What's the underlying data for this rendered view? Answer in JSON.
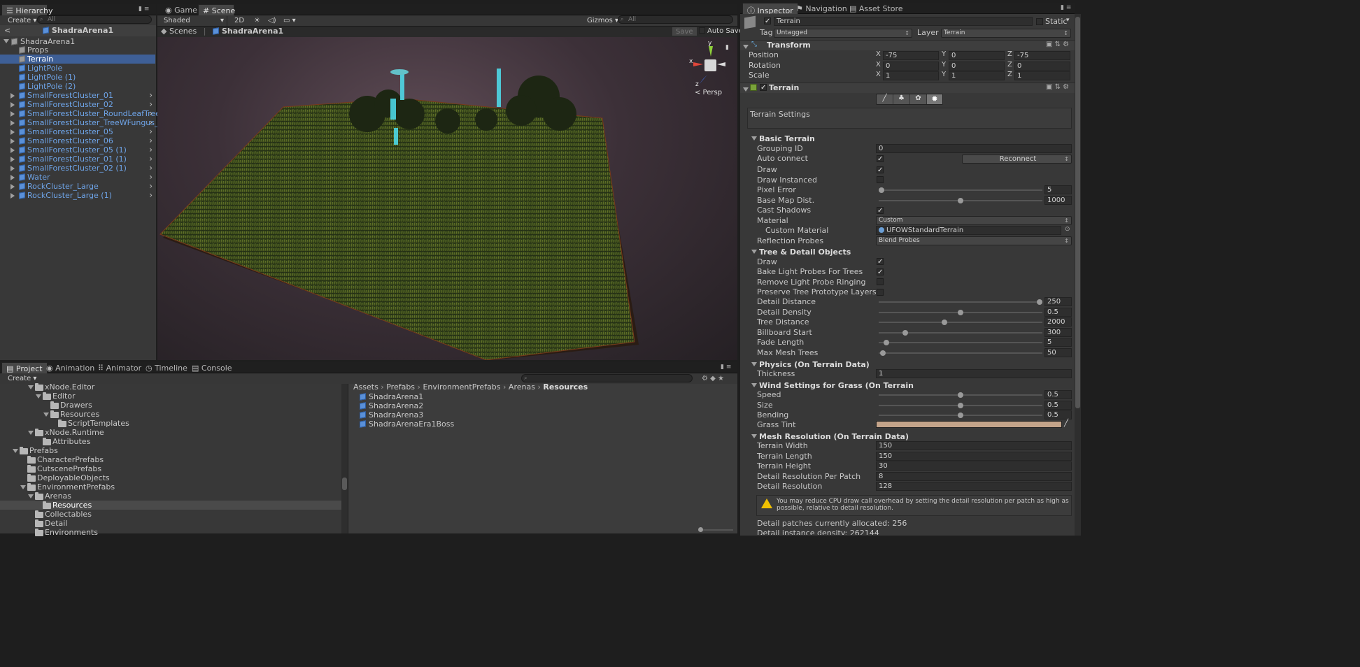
{
  "hierarchy": {
    "tab": "Hierarchy",
    "create": "Create ▾",
    "search_placeholder": "All",
    "scene": "ShadraArena1",
    "root": "ShadraArena1",
    "items": [
      {
        "label": "Props",
        "expand": false,
        "blue": false
      },
      {
        "label": "Terrain",
        "expand": false,
        "blue": false,
        "selected": true
      },
      {
        "label": "LightPole",
        "expand": false,
        "blue": true
      },
      {
        "label": "LightPole (1)",
        "expand": false,
        "blue": true
      },
      {
        "label": "LightPole (2)",
        "expand": false,
        "blue": true
      },
      {
        "label": "SmallForestCluster_01",
        "expand": true,
        "blue": true
      },
      {
        "label": "SmallForestCluster_02",
        "expand": true,
        "blue": true
      },
      {
        "label": "SmallForestCluster_RoundLeafTree_02",
        "expand": true,
        "blue": true
      },
      {
        "label": "SmallForestCluster_TreeWFungus_02",
        "expand": true,
        "blue": true
      },
      {
        "label": "SmallForestCluster_05",
        "expand": true,
        "blue": true
      },
      {
        "label": "SmallForestCluster_06",
        "expand": true,
        "blue": true
      },
      {
        "label": "SmallForestCluster_05 (1)",
        "expand": true,
        "blue": true
      },
      {
        "label": "SmallForestCluster_01 (1)",
        "expand": true,
        "blue": true
      },
      {
        "label": "SmallForestCluster_02 (1)",
        "expand": true,
        "blue": true
      },
      {
        "label": "Water",
        "expand": true,
        "blue": true
      },
      {
        "label": "RockCluster_Large",
        "expand": true,
        "blue": true
      },
      {
        "label": "RockCluster_Large (1)",
        "expand": true,
        "blue": true
      }
    ]
  },
  "scene": {
    "tabs": [
      "Game",
      "Scene"
    ],
    "shading": "Shaded",
    "mode2d": "2D",
    "gizmos": "Gizmos ▾",
    "search_placeholder": "All",
    "breadcrumb_root": "Scenes",
    "breadcrumb_scene": "ShadraArena1",
    "save": "Save",
    "autosave": "Auto Save",
    "persp": "< Persp",
    "axis_y": "y",
    "axis_x": "x",
    "axis_z": "z"
  },
  "project": {
    "tabs": [
      "Project",
      "Animation",
      "Animator",
      "Timeline",
      "Console"
    ],
    "create": "Create ▾",
    "tree": [
      {
        "label": "xNode.Editor",
        "indent": 3,
        "open": true
      },
      {
        "label": "Editor",
        "indent": 4,
        "open": true
      },
      {
        "label": "Drawers",
        "indent": 5,
        "open": false
      },
      {
        "label": "Resources",
        "indent": 5,
        "open": true
      },
      {
        "label": "ScriptTemplates",
        "indent": 6,
        "open": false
      },
      {
        "label": "xNode.Runtime",
        "indent": 3,
        "open": true
      },
      {
        "label": "Attributes",
        "indent": 4,
        "open": false
      },
      {
        "label": "Prefabs",
        "indent": 1,
        "open": true
      },
      {
        "label": "CharacterPrefabs",
        "indent": 2,
        "open": false
      },
      {
        "label": "CutscenePrefabs",
        "indent": 2,
        "open": false
      },
      {
        "label": "DeployableObjects",
        "indent": 2,
        "open": false
      },
      {
        "label": "EnvironmentPrefabs",
        "indent": 2,
        "open": true
      },
      {
        "label": "Arenas",
        "indent": 3,
        "open": true
      },
      {
        "label": "Resources",
        "indent": 4,
        "open": false,
        "selected": true
      },
      {
        "label": "Collectables",
        "indent": 3,
        "open": false
      },
      {
        "label": "Detail",
        "indent": 3,
        "open": false
      },
      {
        "label": "Environments",
        "indent": 3,
        "open": false
      }
    ],
    "path": [
      "Assets",
      "Prefabs",
      "EnvironmentPrefabs",
      "Arenas",
      "Resources"
    ],
    "files": [
      "ShadraArena1",
      "ShadraArena2",
      "ShadraArena3",
      "ShadraArenaEra1Boss"
    ]
  },
  "inspector": {
    "tabs": [
      "Inspector",
      "Navigation",
      "Asset Store"
    ],
    "object_name": "Terrain",
    "static": "Static",
    "tag_label": "Tag",
    "tag": "Untagged",
    "layer_label": "Layer",
    "layer": "Terrain",
    "transform": {
      "title": "Transform",
      "rows": [
        {
          "label": "Position",
          "x": "-75",
          "y": "0",
          "z": "-75"
        },
        {
          "label": "Rotation",
          "x": "0",
          "y": "0",
          "z": "0"
        },
        {
          "label": "Scale",
          "x": "1",
          "y": "1",
          "z": "1"
        }
      ]
    },
    "terrain_title": "Terrain",
    "settings_label": "Terrain Settings",
    "basic": {
      "title": "Basic Terrain",
      "grouping_label": "Grouping ID",
      "grouping": "0",
      "autoconnect_label": "Auto connect",
      "reconnect": "Reconnect",
      "draw_label": "Draw",
      "draw_instanced_label": "Draw Instanced",
      "pixel_error_label": "Pixel Error",
      "pixel_error": "5",
      "pixel_error_frac": 0.0,
      "basemap_label": "Base Map Dist.",
      "basemap": "1000",
      "basemap_frac": 0.5,
      "cast_label": "Cast Shadows",
      "material_label": "Material",
      "material": "Custom",
      "custom_material_label": "Custom Material",
      "custom_material": "UFOWStandardTerrain",
      "reflection_label": "Reflection Probes",
      "reflection": "Blend Probes"
    },
    "tree_detail": {
      "title": "Tree & Detail Objects",
      "draw_label": "Draw",
      "bake_label": "Bake Light Probes For Trees",
      "remove_label": "Remove Light Probe Ringing",
      "preserve_label": "Preserve Tree Prototype Layers",
      "sliders": [
        {
          "label": "Detail Distance",
          "value": "250",
          "frac": 1.0
        },
        {
          "label": "Detail Density",
          "value": "0.5",
          "frac": 0.5
        },
        {
          "label": "Tree Distance",
          "value": "2000",
          "frac": 0.4
        },
        {
          "label": "Billboard Start",
          "value": "300",
          "frac": 0.15
        },
        {
          "label": "Fade Length",
          "value": "5",
          "frac": 0.03
        },
        {
          "label": "Max Mesh Trees",
          "value": "50",
          "frac": 0.01
        }
      ]
    },
    "physics": {
      "title": "Physics (On Terrain Data)",
      "thickness_label": "Thickness",
      "thickness": "1"
    },
    "wind": {
      "title": "Wind Settings for Grass (On Terrain",
      "sliders": [
        {
          "label": "Speed",
          "value": "0.5",
          "frac": 0.5
        },
        {
          "label": "Size",
          "value": "0.5",
          "frac": 0.5
        },
        {
          "label": "Bending",
          "value": "0.5",
          "frac": 0.5
        }
      ],
      "tint_label": "Grass Tint",
      "tint_color": "#c4a48a"
    },
    "mesh": {
      "title": "Mesh Resolution (On Terrain Data)",
      "rows": [
        {
          "label": "Terrain Width",
          "value": "150"
        },
        {
          "label": "Terrain Length",
          "value": "150"
        },
        {
          "label": "Terrain Height",
          "value": "30"
        },
        {
          "label": "Detail Resolution Per Patch",
          "value": "8"
        },
        {
          "label": "Detail Resolution",
          "value": "128"
        }
      ],
      "warning": "You may reduce CPU draw call overhead by setting the detail resolution per patch as high as possible, relative to detail resolution.",
      "patches": "Detail patches currently allocated: 256",
      "density": "Detail instance density: 262144"
    }
  }
}
